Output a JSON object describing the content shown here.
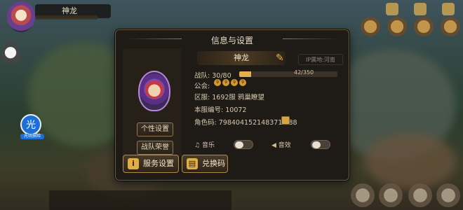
{
  "hud": {
    "player_name": "神龙",
    "badge_label": "光",
    "badge_caption": "光明探险"
  },
  "modal": {
    "title": "信息与设置",
    "name": "神龙",
    "location": "IP属地:河南",
    "team_label": "战队:",
    "team_value": "30/80",
    "exp_text": "42/350",
    "exp_ratio": 0.12,
    "guild_label": "公会:",
    "guild_badges": [
      "9",
      "9",
      "9",
      "9"
    ],
    "server_label": "区服:",
    "server_value": "1692服  鸦巢瞭望",
    "server_no_label": "本服编号:",
    "server_no_value": "10072",
    "role_code_label": "角色码:",
    "role_code_value": "7984041521483712 88",
    "music_label": "音乐",
    "sfx_label": "音效",
    "music_on": false,
    "sfx_on": false,
    "btn_personalize": "个性设置",
    "btn_team_honor": "战队荣誉",
    "btn_service": "服务设置",
    "btn_redeem": "兑换码"
  }
}
